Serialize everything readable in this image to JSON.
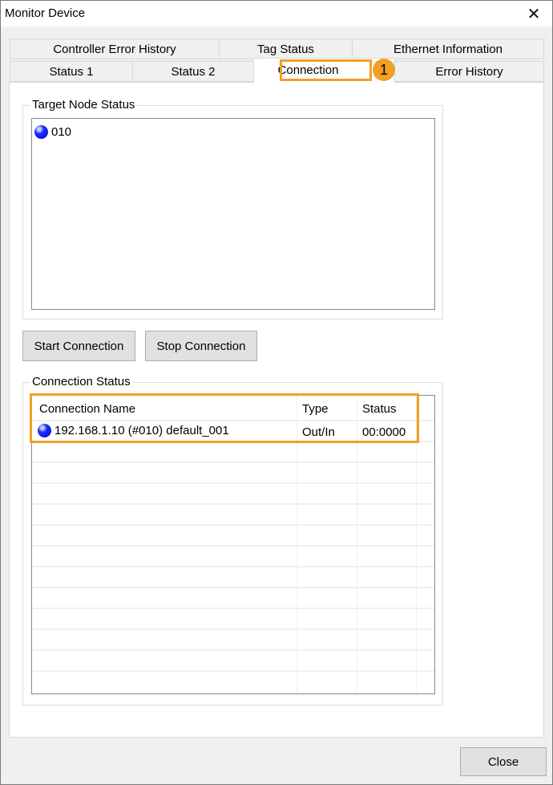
{
  "window": {
    "title": "Monitor Device",
    "close_glyph": "✕"
  },
  "tabs": {
    "row_back": [
      {
        "label": "Controller Error History"
      },
      {
        "label": "Tag Status"
      },
      {
        "label": "Ethernet Information"
      }
    ],
    "row_front": [
      {
        "label": "Status 1"
      },
      {
        "label": "Status 2"
      },
      {
        "label": "Connection",
        "active": true
      },
      {
        "label": "Error History"
      }
    ]
  },
  "annotation": {
    "badge_number": "1",
    "highlight_color": "#f0a028"
  },
  "target_node_status": {
    "title": "Target Node Status",
    "nodes": [
      {
        "label": "010",
        "status_icon": "blue-status-dot",
        "status_color": "#0a14ff"
      }
    ]
  },
  "buttons": {
    "start_connection": "Start Connection",
    "stop_connection": "Stop Connection",
    "close": "Close"
  },
  "connection_status": {
    "title": "Connection Status",
    "columns": [
      "Connection Name",
      "Type",
      "Status"
    ],
    "rows": [
      {
        "name": "192.168.1.10 (#010) default_001",
        "type": "Out/In",
        "status": "00:0000",
        "status_icon": "blue-status-dot"
      }
    ]
  }
}
